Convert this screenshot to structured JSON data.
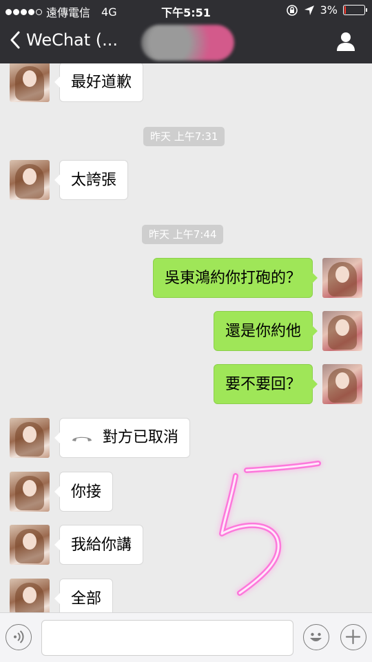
{
  "status_bar": {
    "carrier": "遠傳電信",
    "network": "4G",
    "time": "下午5:51",
    "battery_percent": "3%",
    "signal_dots_filled": 4,
    "signal_dots_total": 5
  },
  "nav": {
    "back_label": "WeChat (..."
  },
  "messages": [
    {
      "side": "in",
      "text": "最好道歉"
    },
    {
      "type": "timestamp",
      "text": "昨天 上午7:31"
    },
    {
      "side": "in",
      "text": "太誇張"
    },
    {
      "type": "timestamp",
      "text": "昨天 上午7:44"
    },
    {
      "side": "out",
      "text": "吳東鴻約你打砲的？"
    },
    {
      "side": "out",
      "text": "還是你約他"
    },
    {
      "side": "out",
      "text": "要不要回？"
    },
    {
      "side": "in",
      "type": "call",
      "text": "對方已取消"
    },
    {
      "side": "in",
      "text": "你接"
    },
    {
      "side": "in",
      "text": "我給你講"
    },
    {
      "side": "in",
      "text": "全部"
    }
  ],
  "icons": {
    "back": "chevron-left-icon",
    "profile": "person-icon",
    "call": "phone-hangup-icon",
    "voice": "voice-icon",
    "emoji": "smiley-icon",
    "more": "plus-icon"
  },
  "colors": {
    "nav_bg": "#2f2f33",
    "chat_bg": "#ebebeb",
    "outgoing_bubble": "#9fe658",
    "incoming_bubble": "#ffffff",
    "overlay_scribble": "#ff4fd2"
  }
}
